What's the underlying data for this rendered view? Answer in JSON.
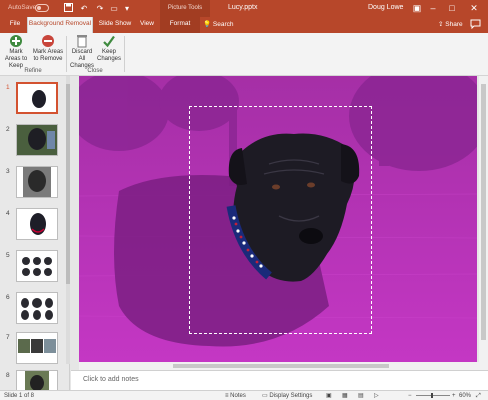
{
  "titlebar": {
    "autosave_label": "AutoSave",
    "context_group": "Picture Tools",
    "doc_title": "Lucy.pptx",
    "user": "Doug Lowe",
    "brand_color": "#b7472a"
  },
  "tabs": {
    "file": "File",
    "background_removal": "Background Removal",
    "slide_show": "Slide Show",
    "view": "View",
    "format": "Format",
    "search": "Search",
    "share": "Share"
  },
  "ribbon": {
    "mark_keep": "Mark Areas to Keep",
    "mark_remove": "Mark Areas to Remove",
    "discard": "Discard All Changes",
    "keep_changes": "Keep Changes",
    "group_refine": "Refine",
    "group_close": "Close"
  },
  "thumbnails": {
    "numbers": [
      "1",
      "2",
      "3",
      "4",
      "5",
      "6",
      "7",
      "8"
    ],
    "selected": "1"
  },
  "notes": {
    "placeholder": "Click to add notes"
  },
  "status": {
    "slide_info": "Slide 1 of 8",
    "notes": "Notes",
    "display_settings": "Display Settings",
    "zoom": "60%",
    "zoom_minus": "−",
    "zoom_plus": "+"
  },
  "colors": {
    "removal_overlay": "#b62fb8",
    "accent": "#d35230"
  }
}
